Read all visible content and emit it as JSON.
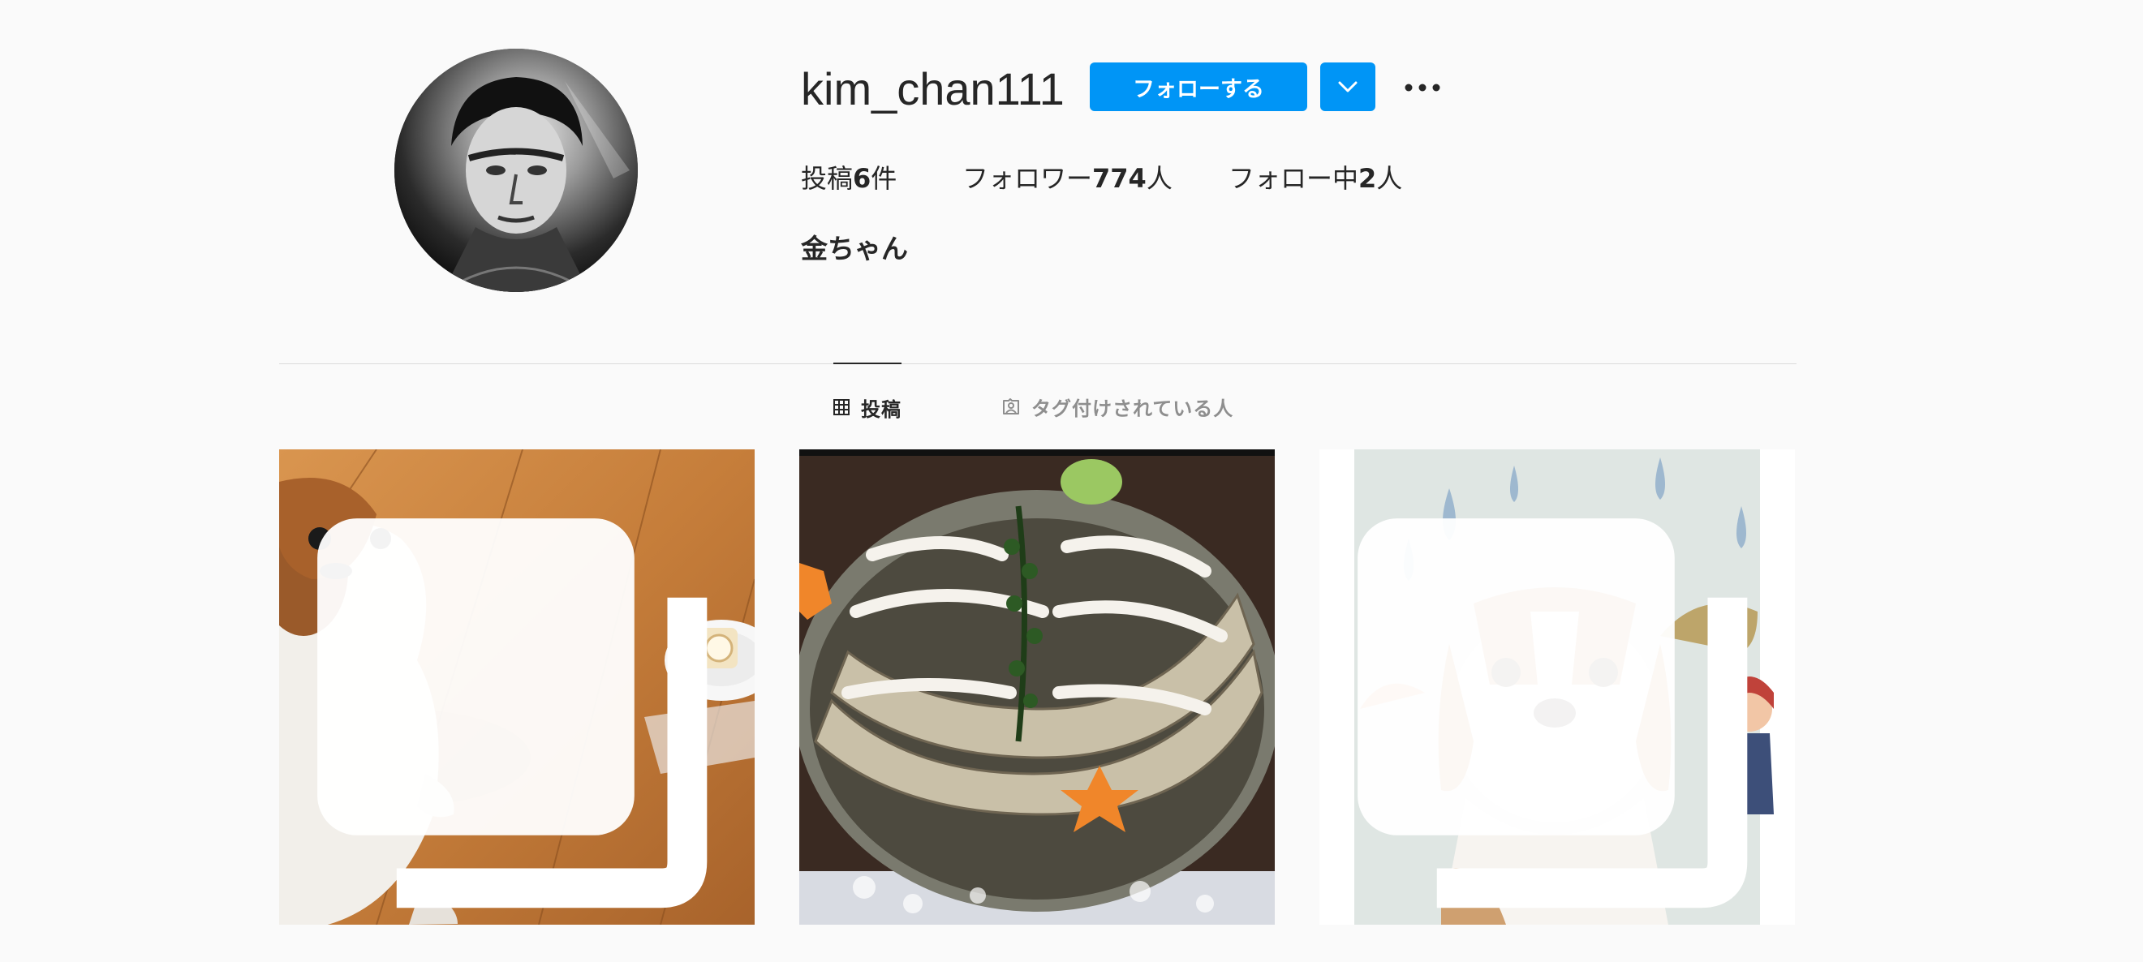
{
  "profile": {
    "username": "kim_chan111",
    "full_name": "金ちゃん",
    "follow_label": "フォローする",
    "stats": {
      "posts_prefix": "投稿",
      "posts_count": "6",
      "posts_suffix": "件",
      "followers_prefix": "フォロワー",
      "followers_count": "774",
      "followers_suffix": "人",
      "following_prefix": "フォロー中",
      "following_count": "2",
      "following_suffix": "人"
    }
  },
  "tabs": [
    {
      "label": "投稿",
      "icon": "grid-icon",
      "active": true
    },
    {
      "label": "タグ付けされている人",
      "icon": "tagged-user-icon",
      "active": false
    }
  ],
  "posts": [
    {
      "subject": "dog-on-wooden-floor",
      "multi": true
    },
    {
      "subject": "abalone-sashimi-platter",
      "multi": false
    },
    {
      "subject": "dog-with-rain-backdrop",
      "multi": true
    }
  ],
  "colors": {
    "accent": "#0095f6",
    "background": "#fafafa",
    "text": "#262626",
    "muted": "#8e8e8e",
    "divider": "#dbdbdb"
  }
}
